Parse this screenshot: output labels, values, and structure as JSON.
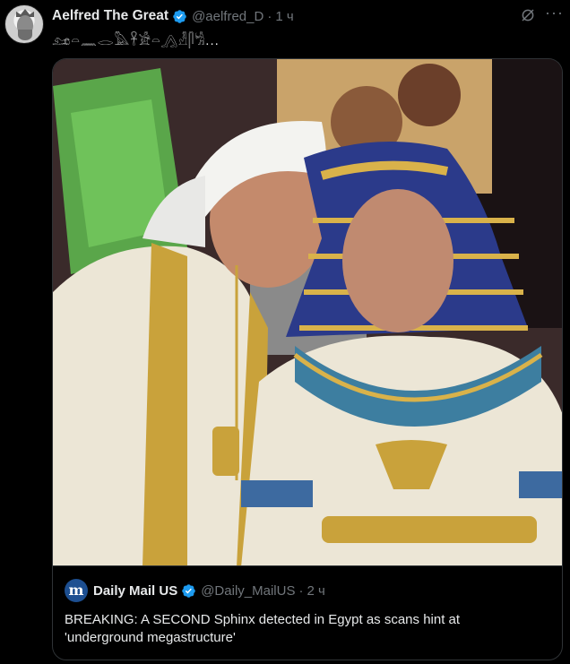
{
  "tweet": {
    "author": {
      "display_name": "Aelfred The Great",
      "handle": "@aelfred_D",
      "verified": true,
      "avatar_icon": "king-portrait-avatar"
    },
    "separator": "·",
    "time": "1 ч",
    "text": "𓃭𓏏𓈖𓂋𓅓𓋹𓀀𓏏𓂻𓁐𓋴𓀜...",
    "media_alt": "Two men dressed in Egyptian costume, one in a pharaoh headdress",
    "colors": {
      "accent": "#1d9bf0",
      "muted": "#71767b",
      "border": "#2f3336",
      "text": "#e7e9ea",
      "background": "#000000"
    }
  },
  "quote": {
    "author": {
      "display_name": "Daily Mail US",
      "handle": "@Daily_MailUS",
      "avatar_letter": "m",
      "verified": true
    },
    "separator": "·",
    "time": "2 ч",
    "text": "BREAKING: A SECOND Sphinx detected in Egypt as scans hint at 'underground megastructure'"
  }
}
